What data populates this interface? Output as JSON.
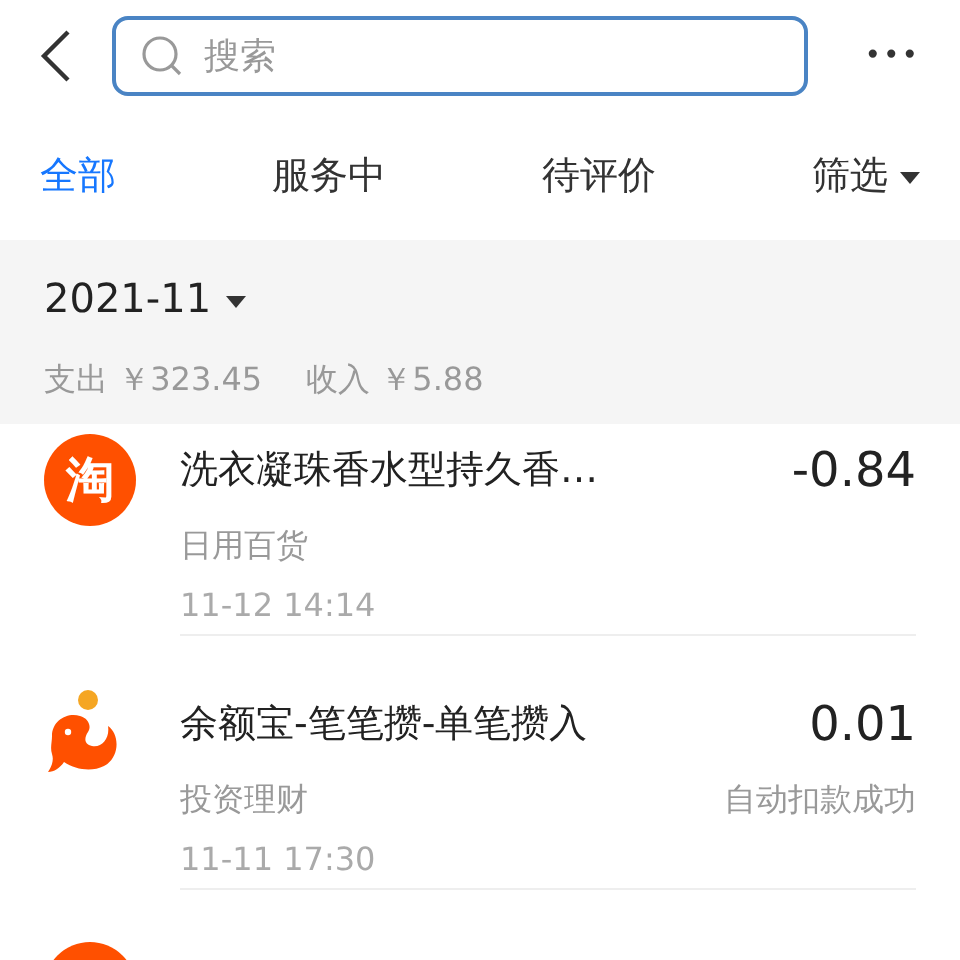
{
  "search": {
    "placeholder": "搜索"
  },
  "more": "•••",
  "tabs": [
    {
      "label": "全部",
      "selected": true
    },
    {
      "label": "服务中",
      "selected": false
    },
    {
      "label": "待评价",
      "selected": false
    },
    {
      "label": "筛选",
      "selected": false,
      "dropdown": true
    }
  ],
  "summary": {
    "month": "2021-11",
    "expense": "支出 ￥323.45",
    "income": "收入 ￥5.88"
  },
  "transactions": [
    {
      "kind": "taobao",
      "logo_text": "淘",
      "title": "洗衣凝珠香水型持久香…",
      "category": "日用百货",
      "time": "11-12  14:14",
      "amount": "-0.84"
    },
    {
      "kind": "yuebao",
      "title": "余额宝-笔笔攒-单笔攒入",
      "category": "投资理财",
      "time": "11-11  17:30",
      "amount": "0.01",
      "status": "自动扣款成功"
    },
    {
      "kind": "taobao"
    }
  ]
}
